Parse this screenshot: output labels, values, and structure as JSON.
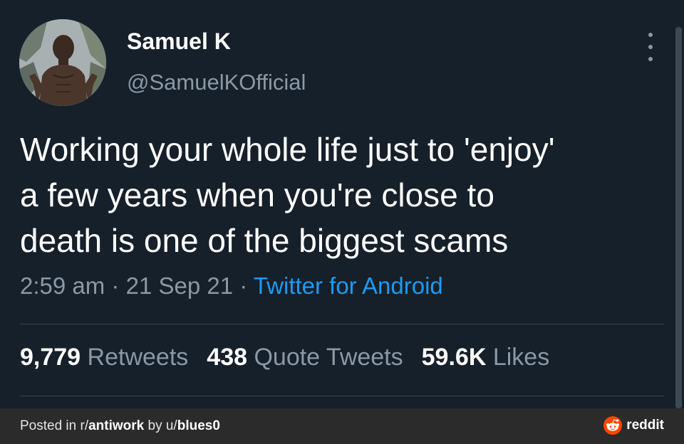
{
  "tweet": {
    "display_name": "Samuel K",
    "handle": "@SamuelKOfficial",
    "text_lines": [
      "Working your whole life just to 'enjoy'",
      "a few years when you're close to",
      "death is one of the biggest scams"
    ],
    "time": "2:59 am",
    "date": "21 Sep 21",
    "source": "Twitter for Android",
    "separator": "·",
    "stats": {
      "retweets_count": "9,779",
      "retweets_label": "Retweets",
      "quotes_count": "438",
      "quotes_label": "Quote Tweets",
      "likes_count": "59.6K",
      "likes_label": "Likes"
    },
    "more_icon": "more-vertical-icon",
    "avatar_icon": "profile-photo"
  },
  "footer": {
    "posted_in": "Posted in r/",
    "subreddit": "antiwork",
    "by": " by u/",
    "username": "blues0",
    "brand": "reddit",
    "brand_icon": "reddit-logo-icon",
    "brand_color": "#ff4500"
  },
  "colors": {
    "background": "#15202b",
    "secondary_text": "#8b98a5",
    "link": "#1d9bf0",
    "footer_bg": "#2b2b2b"
  }
}
